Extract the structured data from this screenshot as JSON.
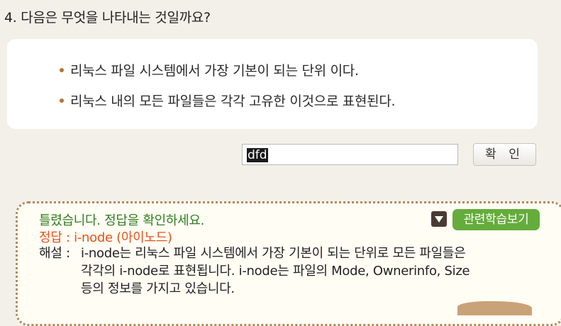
{
  "question": {
    "text": "4. 다음은 무엇을 나타내는 것일까요?"
  },
  "hints": [
    {
      "text": "리눅스 파일 시스템에서 가장 기본이 되는 단위 이다."
    },
    {
      "text": "리눅스 내의 모든 파일들은 각각 고유한 이것으로 표현된다."
    }
  ],
  "answer_input": {
    "value": "dfd"
  },
  "confirm_button": {
    "label": "확 인"
  },
  "feedback": {
    "result": "틀렸습니다.  정답을 확인하세요.",
    "correct_answer": "정답 : i-node (아이노드)",
    "explanation_label": "해설 :",
    "explanation_lines": [
      "i-node는 리눅스 파일 시스템에서 가장 기본이 되는 단위로 모든 파일들은",
      "각각의 i-node로 표현됩니다. i-node는 파일의 Mode, Ownerinfo, Size",
      "등의 정보를 가지고 있습니다."
    ],
    "related_button": "관련학습보기"
  },
  "colors": {
    "wrong_text": "#2f7d1f",
    "answer_text": "#e2541b",
    "related_button_bg": "#64ac3b",
    "bullet": "#b5732f"
  }
}
